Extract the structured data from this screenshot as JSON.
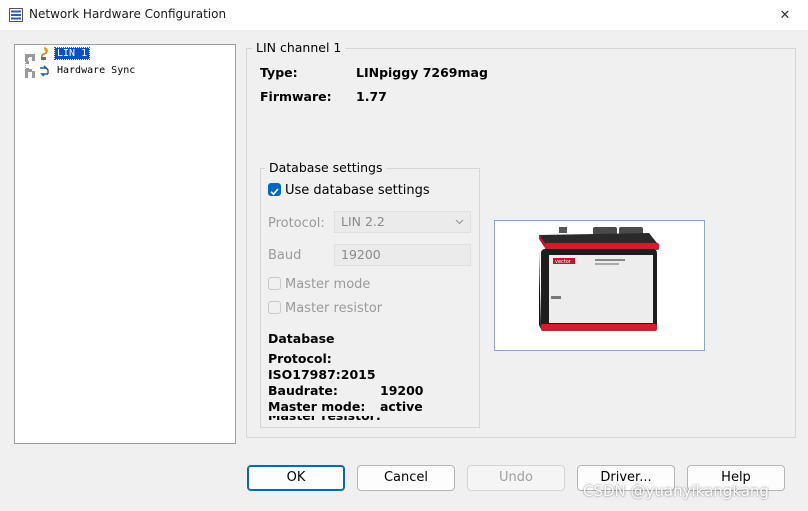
{
  "window": {
    "title": "Network Hardware Configuration",
    "close_glyph": "✕"
  },
  "tree": {
    "items": [
      {
        "label": "LIN 1",
        "icon": "lin-network-icon",
        "selected": true
      },
      {
        "label": "Hardware Sync",
        "icon": "hardware-sync-icon",
        "selected": false
      }
    ]
  },
  "channel": {
    "group_title": "LIN channel 1",
    "type_label": "Type:",
    "type_value": "LINpiggy 7269mag",
    "firmware_label": "Firmware:",
    "firmware_value": "1.77"
  },
  "database_settings": {
    "group_title": "Database settings",
    "use_db_label": "Use database settings",
    "use_db_checked": true,
    "protocol_label": "Protocol:",
    "protocol_value": "LIN 2.2",
    "baud_label": "Baud",
    "baud_value": "19200",
    "master_mode_label": "Master mode",
    "master_resistor_label": "Master resistor",
    "db_heading": "Database",
    "db_protocol_label": "Protocol:",
    "db_protocol_value": "ISO17987:2015",
    "db_baudrate_label": "Baudrate:",
    "db_baudrate_value": "19200",
    "db_master_mode_label": "Master mode:",
    "db_master_mode_value": "active"
  },
  "device": {
    "brand": "vector",
    "picture_icon": "linpiggy-device-image"
  },
  "buttons": {
    "ok": "OK",
    "cancel": "Cancel",
    "undo": "Undo",
    "driver": "Driver...",
    "help": "Help"
  },
  "watermark": "CSDN @yuanyikangkang",
  "colors": {
    "accent": "#0067c0",
    "selection": "#0a50c8"
  }
}
